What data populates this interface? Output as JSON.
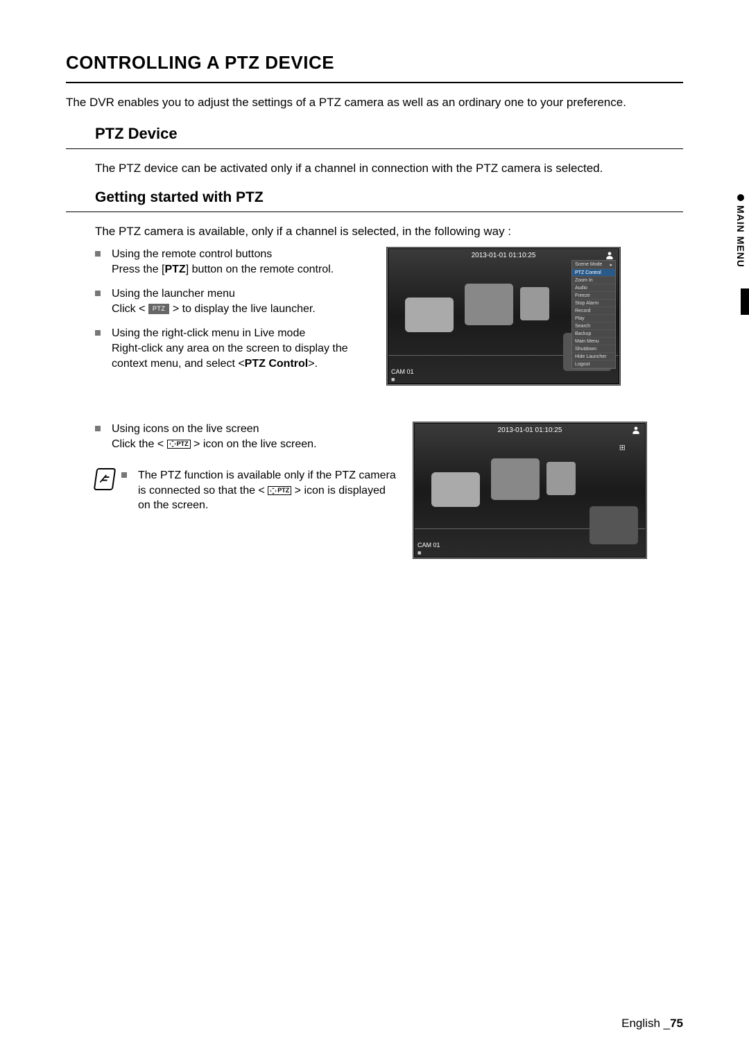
{
  "section_title": "CONTROLLING A PTZ DEVICE",
  "intro": "The DVR enables you to adjust the settings of a PTZ camera as well as an ordinary one to your preference.",
  "sub_title": "PTZ Device",
  "sub_intro": "The PTZ device can be activated only if a channel in connection with the PTZ camera is selected.",
  "subsub_title": "Getting started with PTZ",
  "subsub_intro": "The PTZ camera is available, only if a channel is selected, in the following way :",
  "bullets1": [
    {
      "title": "Using the remote control buttons",
      "desc_pre": "Press the [",
      "desc_bold": "PTZ",
      "desc_post": "] button on the remote control."
    },
    {
      "title": "Using the launcher menu",
      "desc_pre": "Click < ",
      "badge": "PTZ",
      "desc_post": " > to display the live launcher."
    },
    {
      "title": "Using the right-click menu in Live mode",
      "desc_pre": "Right-click any area on the screen to display the context menu, and select <",
      "desc_bold": "PTZ Control",
      "desc_post": ">."
    }
  ],
  "bullets2": [
    {
      "title": "Using icons on the live screen",
      "desc_pre": "Click the < ",
      "icon": "PTZ",
      "desc_post": " > icon on the live screen."
    }
  ],
  "note": {
    "pre": "The PTZ function is available only if the PTZ camera is connected so that the < ",
    "icon": "PTZ",
    "post": " > icon is displayed on the screen."
  },
  "screenshot": {
    "timestamp": "2013-01-01 01:10:25",
    "cam_label": "CAM 01",
    "menu": [
      "Scene Mode",
      "PTZ Control",
      "Zoom In",
      "Audio",
      "Freeze",
      "Stop Alarm",
      "Record",
      "Play",
      "Search",
      "Backup",
      "Main Menu",
      "Shutdown",
      "Hide Launcher",
      "Logout"
    ],
    "highlighted_index": 1
  },
  "side_tab": "MAIN MENU",
  "footer_lang": "English _",
  "footer_page": "75"
}
